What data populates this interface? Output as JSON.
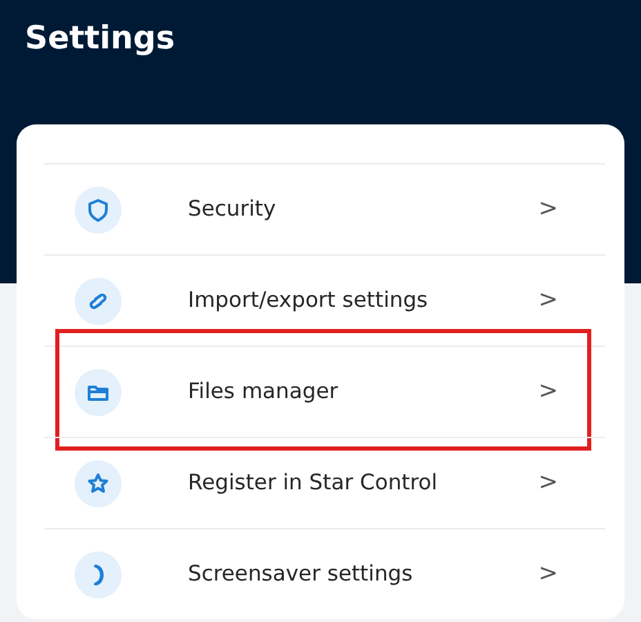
{
  "header": {
    "title": "Settings"
  },
  "items": [
    {
      "label": "Security",
      "kind": "shield",
      "highlighted": false
    },
    {
      "label": "Import/export settings",
      "kind": "link",
      "highlighted": false
    },
    {
      "label": "Files manager",
      "kind": "folder",
      "highlighted": true
    },
    {
      "label": "Register in Star Control",
      "kind": "star",
      "highlighted": false
    },
    {
      "label": "Screensaver settings",
      "kind": "moon",
      "highlighted": false
    }
  ],
  "chevron": ">"
}
